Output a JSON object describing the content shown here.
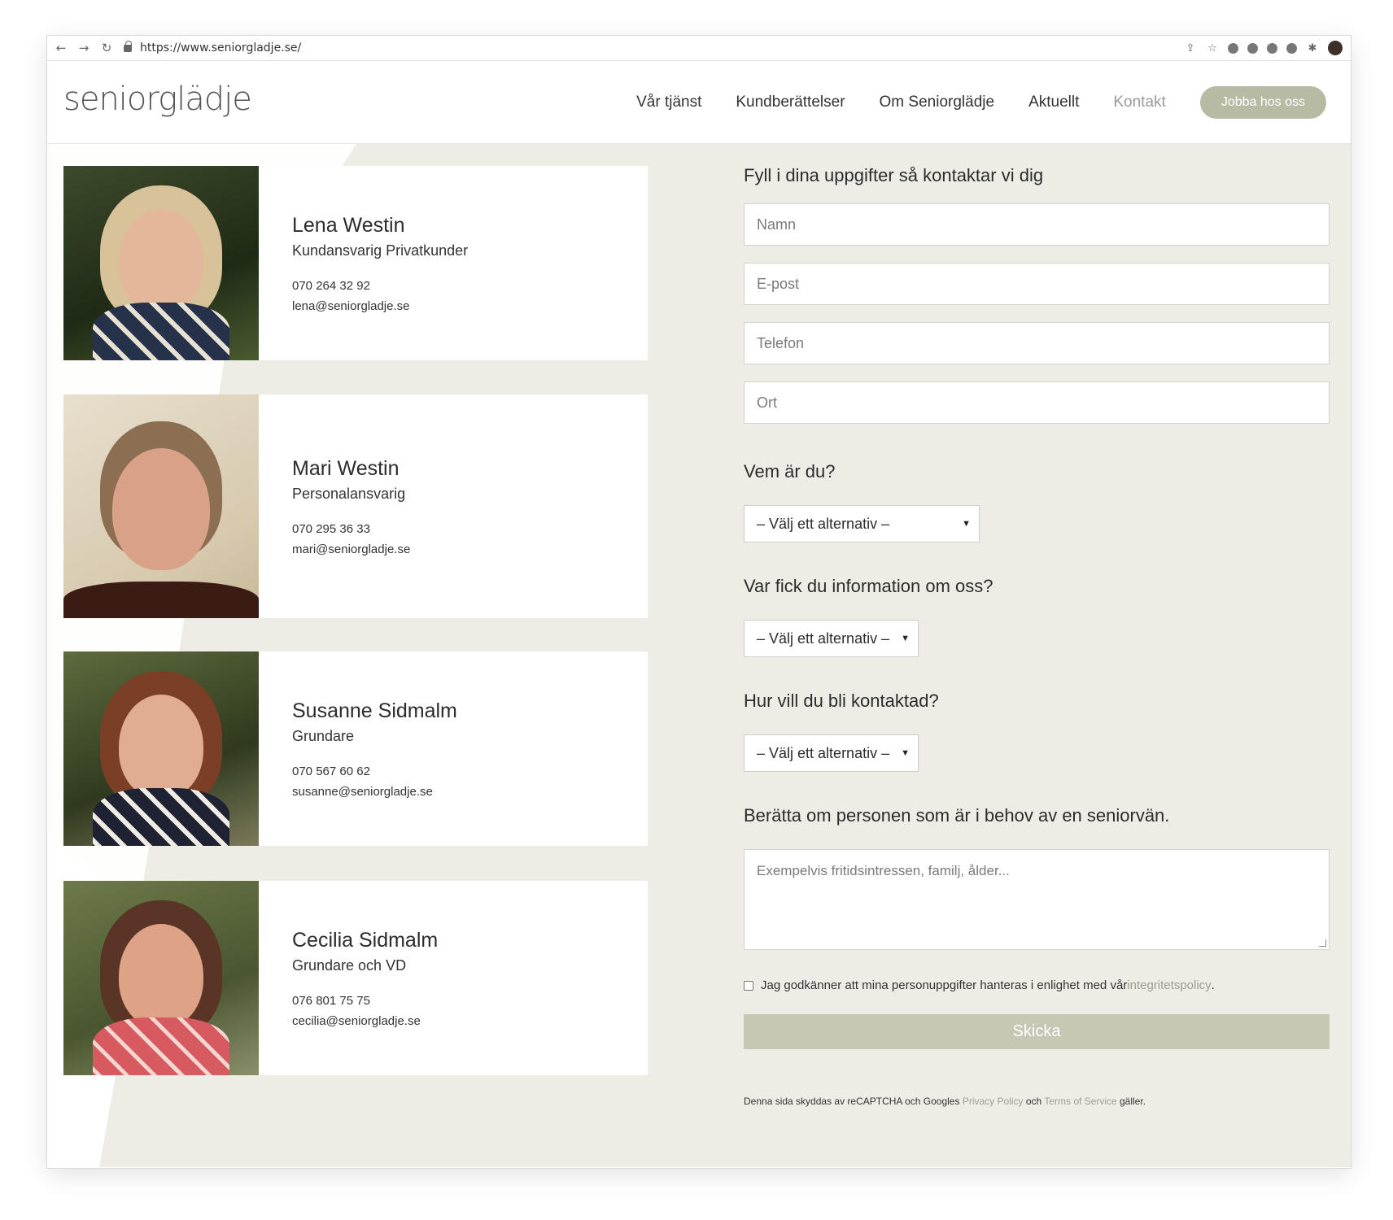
{
  "browser": {
    "url": "https://www.seniorgladje.se/"
  },
  "site": {
    "logo": "seniorglädje",
    "nav": [
      "Vår tjänst",
      "Kundberättelser",
      "Om Seniorglädje",
      "Aktuellt",
      "Kontakt"
    ],
    "cta": "Jobba hos oss"
  },
  "contacts": [
    {
      "name": "Lena Westin",
      "role": "Kundansvarig Privatkunder",
      "phone": "070 264 32 92",
      "email": "lena@seniorgladje.se"
    },
    {
      "name": "Mari Westin",
      "role": "Personalansvarig",
      "phone": "070 295 36 33",
      "email": "mari@seniorgladje.se"
    },
    {
      "name": "Susanne Sidmalm",
      "role": "Grundare",
      "phone": "070 567 60 62",
      "email": "susanne@seniorgladje.se"
    },
    {
      "name": "Cecilia Sidmalm",
      "role": "Grundare och VD",
      "phone": "076 801 75 75",
      "email": "cecilia@seniorgladje.se"
    }
  ],
  "form": {
    "heading": "Fyll i dina uppgifter så kontaktar vi dig",
    "placeholders": {
      "name": "Namn",
      "email": "E-post",
      "phone": "Telefon",
      "city": "Ort"
    },
    "who_label": "Vem är du?",
    "who_value": "– Välj ett alternativ –",
    "source_label": "Var fick du information om oss?",
    "source_value": "– Välj ett alternativ –",
    "contact_label": "Hur vill du bli kontaktad?",
    "contact_value": "– Välj ett alternativ –",
    "about_label": "Berätta om personen som är i behov av en seniorvän.",
    "about_placeholder": "Exempelvis fritidsintressen, familj, ålder...",
    "consent_text": "Jag godkänner att mina personuppgifter hanteras i enlighet med vår ",
    "consent_link": "integritetspolicy",
    "consent_end": ".",
    "submit": "Skicka",
    "recaptcha_pre": "Denna sida skyddas av reCAPTCHA och Googles ",
    "recaptcha_privacy": "Privacy Policy",
    "recaptcha_mid": " och ",
    "recaptcha_terms": "Terms of Service",
    "recaptcha_post": " gäller."
  },
  "colors": {
    "background": "#edede6",
    "accent": "#b8bba4",
    "submit": "#c6c8b3",
    "link": "#9c9c8f"
  }
}
